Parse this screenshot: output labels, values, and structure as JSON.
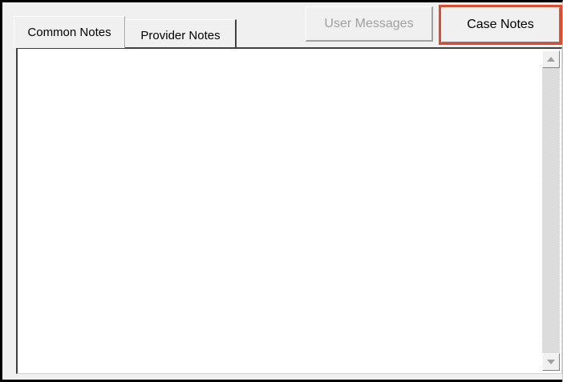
{
  "tabs": {
    "common": "Common Notes",
    "provider": "Provider Notes"
  },
  "buttons": {
    "user_messages": "User Messages",
    "case_notes": "Case Notes"
  },
  "notes": {
    "text": ""
  },
  "colors": {
    "highlight": "#e8472a",
    "disabled_text": "#a0a0a0",
    "face": "#f0f0f0"
  },
  "icons": {
    "scroll_up": "scroll-up-arrow-icon",
    "scroll_down": "scroll-down-arrow-icon"
  }
}
